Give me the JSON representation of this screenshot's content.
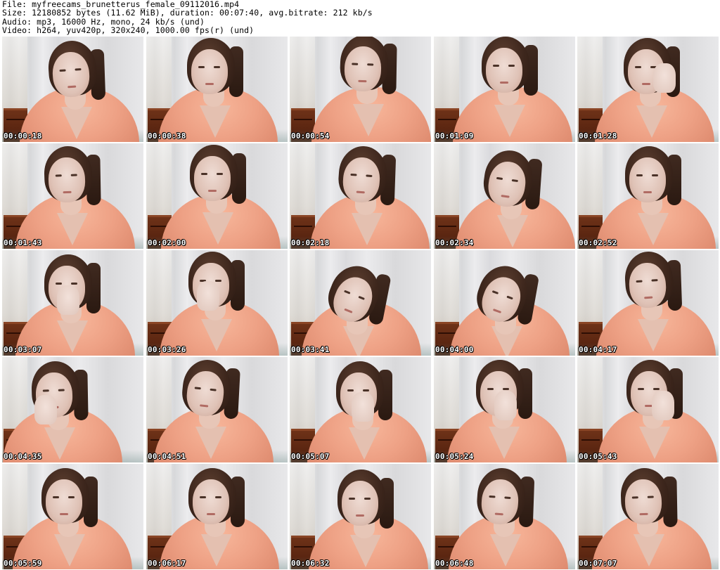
{
  "info": {
    "file": "File: myfreecams_brunetterus_female_09112016.mp4",
    "size": "Size: 12180852 bytes (11.62 MiB), duration: 00:07:40, avg.bitrate: 212 kb/s",
    "audio": "Audio: mp3, 16000 Hz, mono, 24 kb/s (und)",
    "video": "Video: h264, yuv420p, 320x240, 1000.00 fps(r) (und)"
  },
  "thumbnails": [
    {
      "ts": "00:00:18"
    },
    {
      "ts": "00:00:38"
    },
    {
      "ts": "00:00:54"
    },
    {
      "ts": "00:01:09"
    },
    {
      "ts": "00:01:28"
    },
    {
      "ts": "00:01:43"
    },
    {
      "ts": "00:02:00"
    },
    {
      "ts": "00:02:18"
    },
    {
      "ts": "00:02:34"
    },
    {
      "ts": "00:02:52"
    },
    {
      "ts": "00:03:07"
    },
    {
      "ts": "00:03:26"
    },
    {
      "ts": "00:03:41"
    },
    {
      "ts": "00:04:00"
    },
    {
      "ts": "00:04:17"
    },
    {
      "ts": "00:04:35"
    },
    {
      "ts": "00:04:51"
    },
    {
      "ts": "00:05:07"
    },
    {
      "ts": "00:05:24"
    },
    {
      "ts": "00:05:43"
    },
    {
      "ts": "00:05:59"
    },
    {
      "ts": "00:06:17"
    },
    {
      "ts": "00:06:32"
    },
    {
      "ts": "00:06:48"
    },
    {
      "ts": "00:07:07"
    }
  ]
}
